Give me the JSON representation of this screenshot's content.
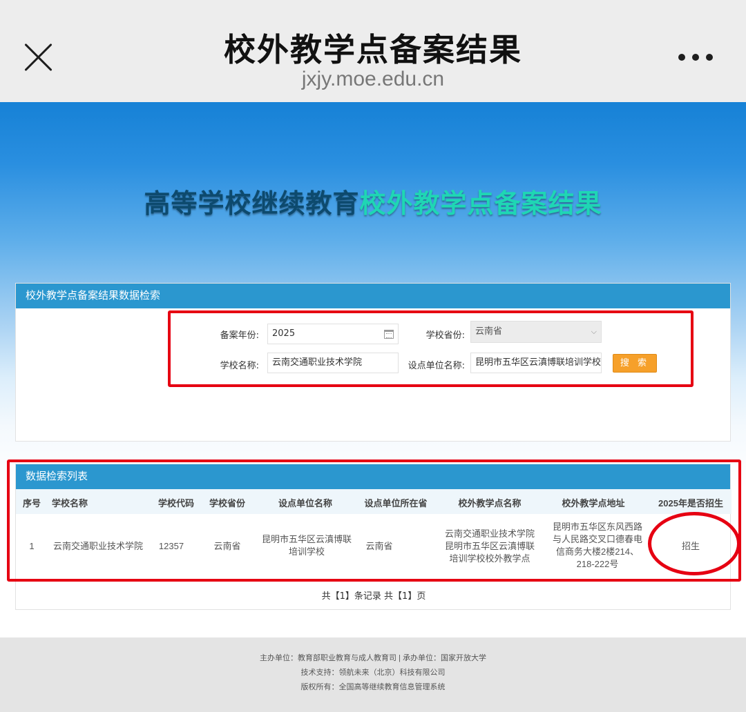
{
  "topbar": {
    "title": "校外教学点备案结果",
    "url": "jxjy.moe.edu.cn"
  },
  "banner": {
    "title_part1": "高等学校继续教育",
    "title_part2": "校外教学点备案结果"
  },
  "search_panel": {
    "header": "校外教学点备案结果数据检索",
    "year_label": "备案年份:",
    "year_value": "2025",
    "province_label": "学校省份:",
    "province_value": "云南省",
    "school_label": "学校名称:",
    "school_value": "云南交通职业技术学院",
    "unit_label": "设点单位名称:",
    "unit_value": "昆明市五华区云滇博联培训学校",
    "search_button": "搜 索"
  },
  "list_panel": {
    "header": "数据检索列表",
    "columns": [
      "序号",
      "学校名称",
      "学校代码",
      "学校省份",
      "设点单位名称",
      "设点单位所在省",
      "校外教学点名称",
      "校外教学点地址",
      "2025年是否招生"
    ],
    "rows": [
      {
        "index": "1",
        "school": "云南交通职业技术学院",
        "code": "12357",
        "province": "云南省",
        "unit_line1": "昆明市五华区云滇博联",
        "unit_line2": "培训学校",
        "unit_province": "云南省",
        "site_line1": "云南交通职业技术学院",
        "site_line2": "昆明市五华区云滇博联",
        "site_line3": "培训学校校外教学点",
        "addr_line1": "昆明市五华区东风西路",
        "addr_line2": "与人民路交叉口德春电",
        "addr_line3": "信商务大楼2楼214、",
        "addr_line4": "218-222号",
        "enroll": "招生"
      }
    ],
    "pager": "共【1】条记录 共【1】页"
  },
  "footer": {
    "line1": "主办单位：教育部职业教育与成人教育司 | 承办单位：国家开放大学",
    "line2": "技术支持：领航未来（北京）科技有限公司",
    "line3": "版权所有：全国高等继续教育信息管理系统"
  },
  "colors": {
    "annotation_red": "#e60012",
    "panel_header": "#2b97cf",
    "search_button": "#f6a02a"
  }
}
